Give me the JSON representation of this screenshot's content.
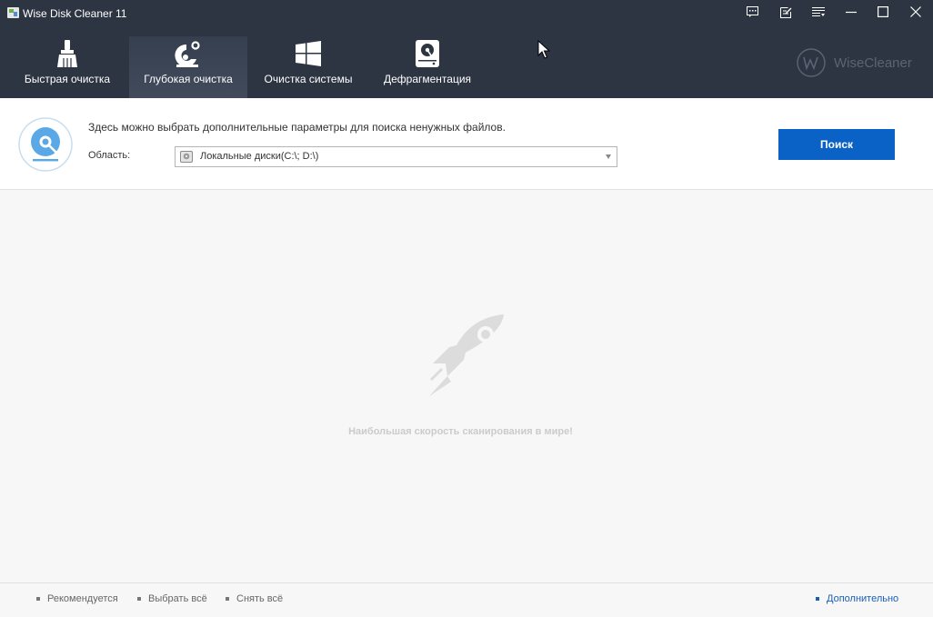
{
  "window": {
    "title": "Wise Disk Cleaner 11",
    "controls": [
      "feedback-icon",
      "checklist-icon",
      "menu-icon",
      "minimize-icon",
      "maximize-icon",
      "close-icon"
    ]
  },
  "nav": {
    "tabs": [
      {
        "label": "Быстрая очистка",
        "icon": "broom-icon",
        "active": false
      },
      {
        "label": "Глубокая очистка",
        "icon": "deep-clean-icon",
        "active": true
      },
      {
        "label": "Очистка системы",
        "icon": "windows-icon",
        "active": false
      },
      {
        "label": "Дефрагментация",
        "icon": "disk-defrag-icon",
        "active": false
      }
    ]
  },
  "logo": {
    "text": "WiseCleaner"
  },
  "panel": {
    "description": "Здесь можно выбрать дополнительные параметры для поиска ненужных файлов.",
    "area_label": "Область:",
    "area_value": "Локальные диски(C:\\; D:\\)",
    "search_button": "Поиск"
  },
  "empty_state": {
    "message": "Наибольшая скорость сканирования в мире!"
  },
  "footer": {
    "recommended": "Рекомендуется",
    "select_all": "Выбрать всё",
    "deselect_all": "Снять всё",
    "advanced": "Дополнительно"
  },
  "colors": {
    "header_bg": "#2d3543",
    "accent_blue": "#0a62c6",
    "link_blue": "#1a5fb4",
    "panel_icon_blue": "#5aa9e6"
  }
}
